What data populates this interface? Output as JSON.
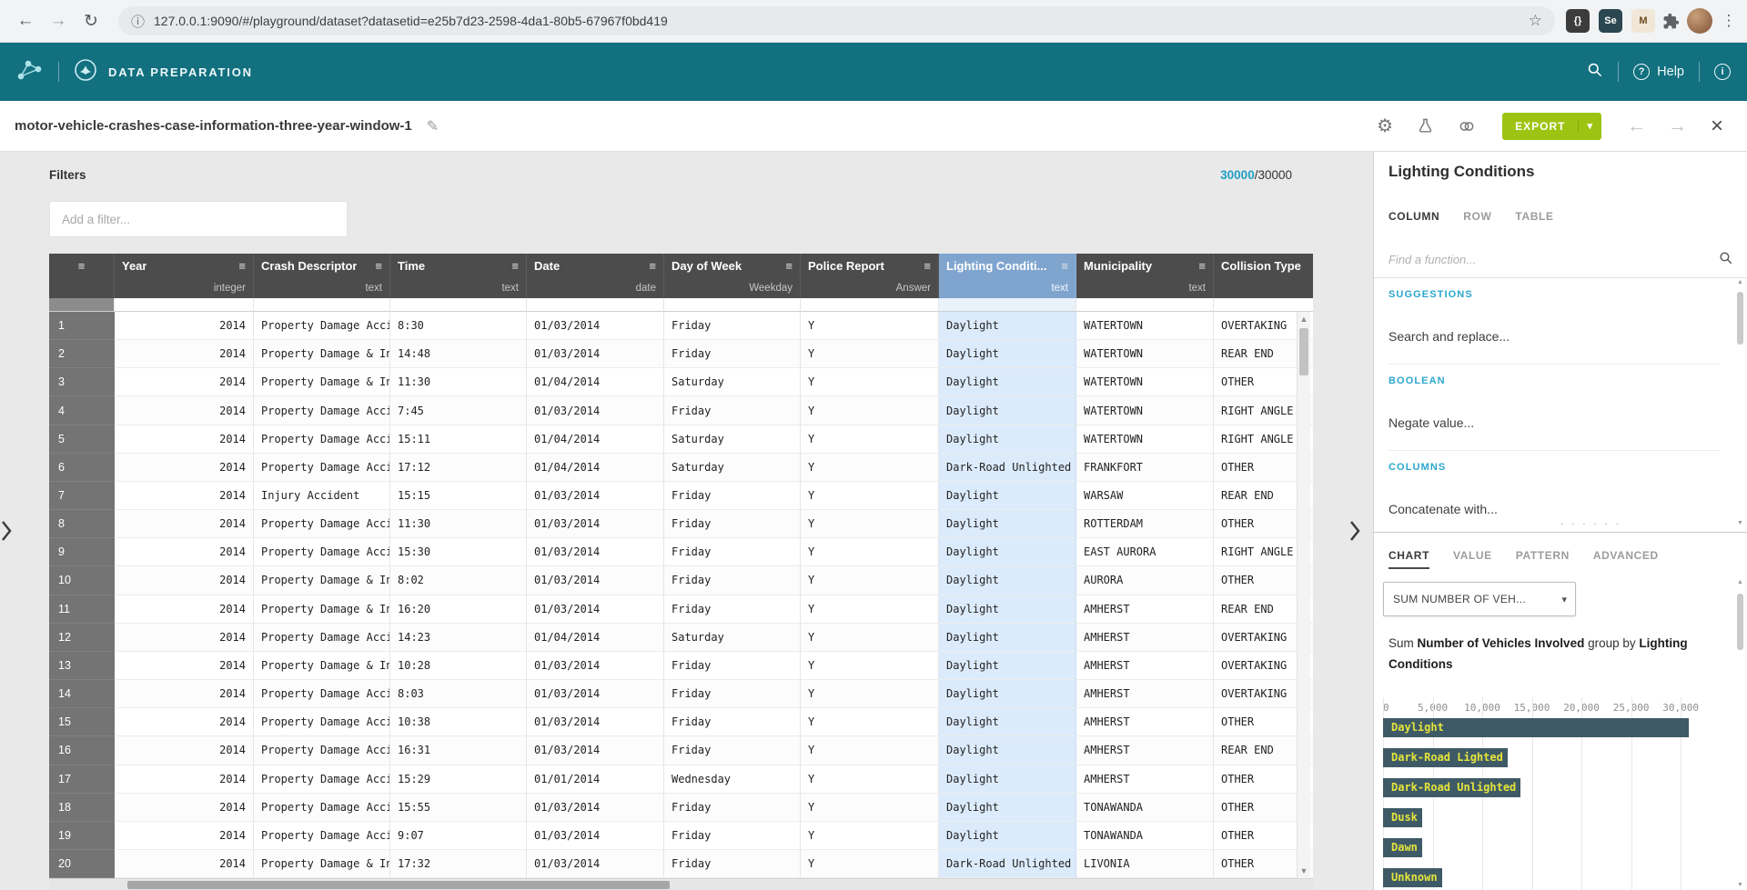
{
  "browser": {
    "url": "127.0.0.1:9090/#/playground/dataset?datasetid=e25b7d23-2598-4da1-80b5-67967f0bd419",
    "extensions": [
      "{}",
      "Se",
      "M"
    ]
  },
  "appbar": {
    "title": "DATA PREPARATION",
    "help_label": "Help"
  },
  "toolbar": {
    "dataset_title": "motor-vehicle-crashes-case-information-three-year-window-1",
    "export_label": "EXPORT"
  },
  "filters": {
    "label": "Filters",
    "placeholder": "Add a filter...",
    "count_current": "30000",
    "count_total": "/30000"
  },
  "table": {
    "columns": [
      {
        "name": "Year",
        "type": "integer",
        "align": "right"
      },
      {
        "name": "Crash Descriptor",
        "type": "text",
        "align": "left"
      },
      {
        "name": "Time",
        "type": "text",
        "align": "left"
      },
      {
        "name": "Date",
        "type": "date",
        "align": "left"
      },
      {
        "name": "Day of Week",
        "type": "Weekday",
        "align": "left"
      },
      {
        "name": "Police Report",
        "type": "Answer",
        "align": "left"
      },
      {
        "name": "Lighting Conditi...",
        "type": "text",
        "align": "left",
        "selected": true
      },
      {
        "name": "Municipality",
        "type": "text",
        "align": "left"
      },
      {
        "name": "Collision Type",
        "type": "",
        "align": "left"
      }
    ],
    "rows": [
      [
        "2014",
        "Property Damage Accid",
        "8:30",
        "01/03/2014",
        "Friday",
        "Y",
        "Daylight",
        "WATERTOWN",
        "OVERTAKING"
      ],
      [
        "2014",
        "Property Damage & Inj",
        "14:48",
        "01/03/2014",
        "Friday",
        "Y",
        "Daylight",
        "WATERTOWN",
        "REAR END"
      ],
      [
        "2014",
        "Property Damage & Inj",
        "11:30",
        "01/04/2014",
        "Saturday",
        "Y",
        "Daylight",
        "WATERTOWN",
        "OTHER"
      ],
      [
        "2014",
        "Property Damage Accid",
        "7:45",
        "01/03/2014",
        "Friday",
        "Y",
        "Daylight",
        "WATERTOWN",
        "RIGHT ANGLE"
      ],
      [
        "2014",
        "Property Damage Accid",
        "15:11",
        "01/04/2014",
        "Saturday",
        "Y",
        "Daylight",
        "WATERTOWN",
        "RIGHT ANGLE"
      ],
      [
        "2014",
        "Property Damage Accid",
        "17:12",
        "01/04/2014",
        "Saturday",
        "Y",
        "Dark-Road Unlighted",
        "FRANKFORT",
        "OTHER"
      ],
      [
        "2014",
        "Injury Accident",
        "15:15",
        "01/03/2014",
        "Friday",
        "Y",
        "Daylight",
        "WARSAW",
        "REAR END"
      ],
      [
        "2014",
        "Property Damage Accid",
        "11:30",
        "01/03/2014",
        "Friday",
        "Y",
        "Daylight",
        "ROTTERDAM",
        "OTHER"
      ],
      [
        "2014",
        "Property Damage Accid",
        "15:30",
        "01/03/2014",
        "Friday",
        "Y",
        "Daylight",
        "EAST AURORA",
        "RIGHT ANGLE"
      ],
      [
        "2014",
        "Property Damage & Inj",
        "8:02",
        "01/03/2014",
        "Friday",
        "Y",
        "Daylight",
        "AURORA",
        "OTHER"
      ],
      [
        "2014",
        "Property Damage & Inj",
        "16:20",
        "01/03/2014",
        "Friday",
        "Y",
        "Daylight",
        "AMHERST",
        "REAR END"
      ],
      [
        "2014",
        "Property Damage Accid",
        "14:23",
        "01/04/2014",
        "Saturday",
        "Y",
        "Daylight",
        "AMHERST",
        "OVERTAKING"
      ],
      [
        "2014",
        "Property Damage & Inj",
        "10:28",
        "01/03/2014",
        "Friday",
        "Y",
        "Daylight",
        "AMHERST",
        "OVERTAKING"
      ],
      [
        "2014",
        "Property Damage Accid",
        "8:03",
        "01/03/2014",
        "Friday",
        "Y",
        "Daylight",
        "AMHERST",
        "OVERTAKING"
      ],
      [
        "2014",
        "Property Damage Accid",
        "10:38",
        "01/03/2014",
        "Friday",
        "Y",
        "Daylight",
        "AMHERST",
        "OTHER"
      ],
      [
        "2014",
        "Property Damage Accid",
        "16:31",
        "01/03/2014",
        "Friday",
        "Y",
        "Daylight",
        "AMHERST",
        "REAR END"
      ],
      [
        "2014",
        "Property Damage Accid",
        "15:29",
        "01/01/2014",
        "Wednesday",
        "Y",
        "Daylight",
        "AMHERST",
        "OTHER"
      ],
      [
        "2014",
        "Property Damage Accid",
        "15:55",
        "01/03/2014",
        "Friday",
        "Y",
        "Daylight",
        "TONAWANDA",
        "OTHER"
      ],
      [
        "2014",
        "Property Damage Accid",
        "9:07",
        "01/03/2014",
        "Friday",
        "Y",
        "Daylight",
        "TONAWANDA",
        "OTHER"
      ],
      [
        "2014",
        "Property Damage & Inj",
        "17:32",
        "01/03/2014",
        "Friday",
        "Y",
        "Dark-Road Unlighted",
        "LIVONIA",
        "OTHER"
      ]
    ]
  },
  "panel": {
    "title": "Lighting Conditions",
    "tabs_top": [
      "COLUMN",
      "ROW",
      "TABLE"
    ],
    "active_tab_top": "COLUMN",
    "search_placeholder": "Find a function...",
    "sections": [
      {
        "label": "SUGGESTIONS",
        "items": [
          "Search and replace..."
        ]
      },
      {
        "label": "BOOLEAN",
        "items": [
          "Negate value..."
        ]
      },
      {
        "label": "COLUMNS",
        "items": [
          "Concatenate with..."
        ]
      }
    ],
    "tabs_bottom": [
      "CHART",
      "VALUE",
      "PATTERN",
      "ADVANCED"
    ],
    "active_tab_bottom": "CHART",
    "aggregation_select": "SUM NUMBER OF VEH...",
    "summary": {
      "prefix": "Sum ",
      "measure": "Number of Vehicles Involved",
      "middle": " group by ",
      "dimension": "Lighting Conditions"
    }
  },
  "chart_data": {
    "type": "bar",
    "orientation": "horizontal",
    "title": "Sum Number of Vehicles Involved group by Lighting Conditions",
    "categories": [
      "Daylight",
      "Dark-Road Lighted",
      "Dark-Road Unlighted",
      "Dusk",
      "Dawn",
      "Unknown"
    ],
    "values": [
      30800,
      9700,
      10400,
      1400,
      1000,
      800
    ],
    "xlabel": "",
    "ylabel": "",
    "xlim": [
      0,
      31000
    ],
    "xticks": [
      "0",
      "5,000",
      "10,000",
      "15,000",
      "20,000",
      "25,000",
      "30,000"
    ],
    "grid": true,
    "legend": false,
    "bar_color": "#3e5a66",
    "label_color": "#e4e43c"
  },
  "colors": {
    "appbar_teal": "#12707f",
    "accent_teal": "#2ba7cd",
    "export_green": "#9dc413",
    "selected_column_header": "#7fa5cf",
    "selected_column_cell": "#dcebfb",
    "table_header_gray": "#4c4c4c"
  },
  "icons": {
    "back": "←",
    "forward": "→",
    "reload": "↻",
    "page_info": "ⓘ",
    "bookmark_star": "☆",
    "kebab_menu": "⋮",
    "hamburger": "≡",
    "edit_pencil": "✎",
    "settings_gear": "⚙",
    "caret_down": "▾",
    "nav_back": "←",
    "nav_forward": "→",
    "close": "×",
    "help_question": "?",
    "info_i": "i",
    "scroll_up": "▲",
    "scroll_down": "▼",
    "dots_handle": "· · · · · ·"
  }
}
